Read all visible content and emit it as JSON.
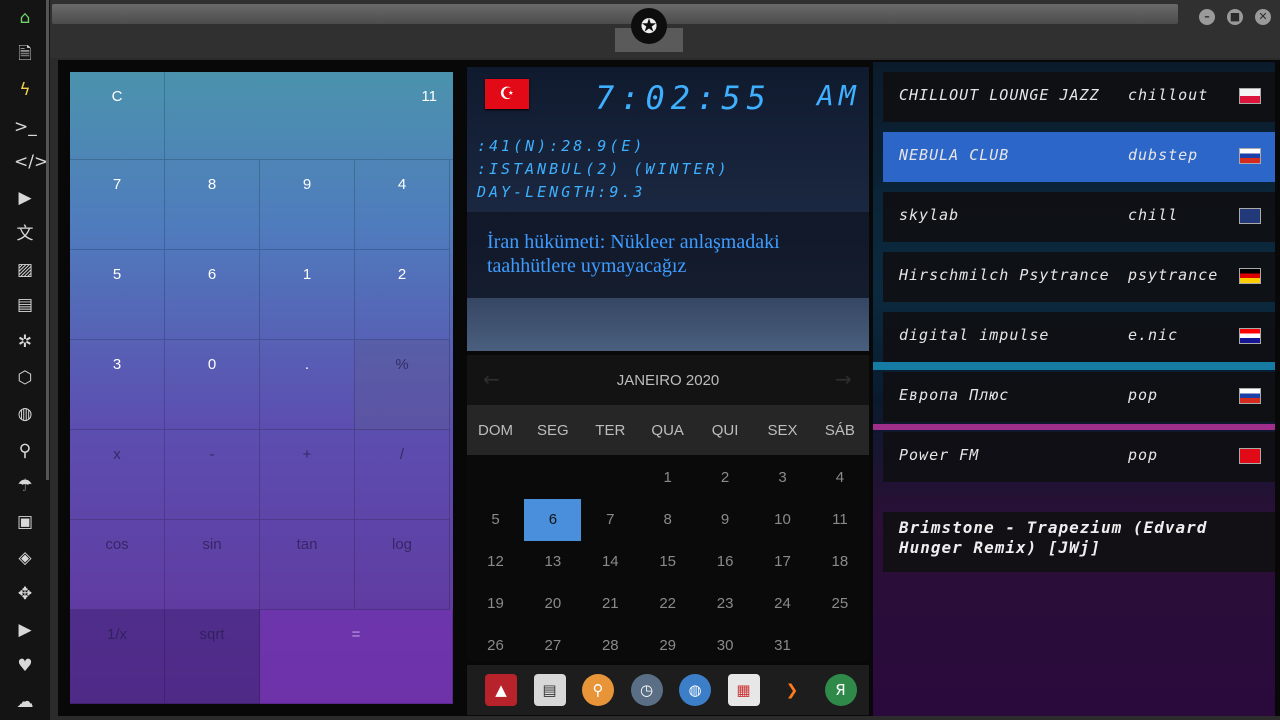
{
  "window": {
    "logo_glyph": "✪",
    "minimize": "–",
    "maximize": "■",
    "close": "✕"
  },
  "sidebar": {
    "icons": [
      "home-icon",
      "document-icon",
      "lightning-icon",
      "terminal-icon",
      "code-icon",
      "play-icon",
      "translate-icon",
      "image-icon",
      "news-icon",
      "settings-gear-icon",
      "hexagon-icon",
      "globe-icon",
      "search-icon",
      "umbrella-icon",
      "contacts-icon",
      "tag-icon",
      "expand-icon",
      "youtube-icon",
      "heart-icon",
      "cloud-icon"
    ],
    "glyphs": [
      "⌂",
      "🗎",
      "ϟ",
      ">_",
      "</>",
      "▶",
      "文",
      "▨",
      "▤",
      "✲",
      "⬡",
      "◍",
      "⚲",
      "☂",
      "▣",
      "◈",
      "✥",
      "▶",
      "♥",
      "☁"
    ]
  },
  "calculator": {
    "display": "11",
    "clear": "C",
    "rows": [
      [
        "7",
        "8",
        "9",
        "4"
      ],
      [
        "5",
        "6",
        "1",
        "2"
      ],
      [
        "3",
        "0",
        ".",
        "%"
      ],
      [
        "x",
        "-",
        "+",
        "/"
      ],
      [
        "cos",
        "sin",
        "tan",
        "log"
      ]
    ],
    "bottom": [
      "1/x",
      "sqrt",
      "="
    ]
  },
  "clock": {
    "time": "7:02:55",
    "ampm": "AM",
    "coords": ":41(N):28.9(E)",
    "city": ":ISTANBUL(2) (WINTER)",
    "daylength": "DAY-LENGTH:9.3",
    "flag_glyph": "☪",
    "news": "İran hükümeti: Nükleer anlaşmadaki taahhütlere uymayacağız"
  },
  "calendar": {
    "month": "JANEIRO 2020",
    "prev": "←",
    "next": "→",
    "weekdays": [
      "DOM",
      "SEG",
      "TER",
      "QUA",
      "QUI",
      "SEX",
      "SÁB"
    ],
    "weeks": [
      [
        "",
        "",
        "",
        "1",
        "2",
        "3",
        "4"
      ],
      [
        "5",
        "6",
        "7",
        "8",
        "9",
        "10",
        "11"
      ],
      [
        "12",
        "13",
        "14",
        "15",
        "16",
        "17",
        "18"
      ],
      [
        "19",
        "20",
        "21",
        "22",
        "23",
        "24",
        "25"
      ],
      [
        "26",
        "27",
        "28",
        "29",
        "30",
        "31",
        ""
      ]
    ],
    "selected": "6"
  },
  "dock": {
    "apps": [
      "launcher-icon",
      "newspaper-icon",
      "search-icon",
      "clock-icon",
      "globe-icon",
      "calendar-icon",
      "play-icon",
      "yandex-icon"
    ],
    "glyphs": [
      "▲",
      "▤",
      "⚲",
      "◷",
      "◍",
      "▦",
      "❯",
      "Я"
    ]
  },
  "radio": {
    "stations": [
      {
        "name": "CHILLOUT LOUNGE JAZZ",
        "genre": "chillout",
        "flag": "pl"
      },
      {
        "name": "NEBULA CLUB",
        "genre": "dubstep",
        "flag": "ru"
      },
      {
        "name": "skylab",
        "genre": "chill",
        "flag": "gb"
      },
      {
        "name": "Hirschmilch Psytrance",
        "genre": "psytrance",
        "flag": "de"
      },
      {
        "name": "digital impulse",
        "genre": "e.nic",
        "flag": "hr"
      },
      {
        "name": "Европа Плюс",
        "genre": "pop",
        "flag": "ru"
      },
      {
        "name": "Power FM",
        "genre": "pop",
        "flag": "tr"
      }
    ],
    "active_index": 1,
    "now_playing": "Brimstone - Trapezium (Edvard Hunger Remix) [JWj]"
  },
  "colors": {
    "accent": "#3fb0ff",
    "selected_day": "#4a8fdc",
    "active_station": "#2d66c9"
  }
}
